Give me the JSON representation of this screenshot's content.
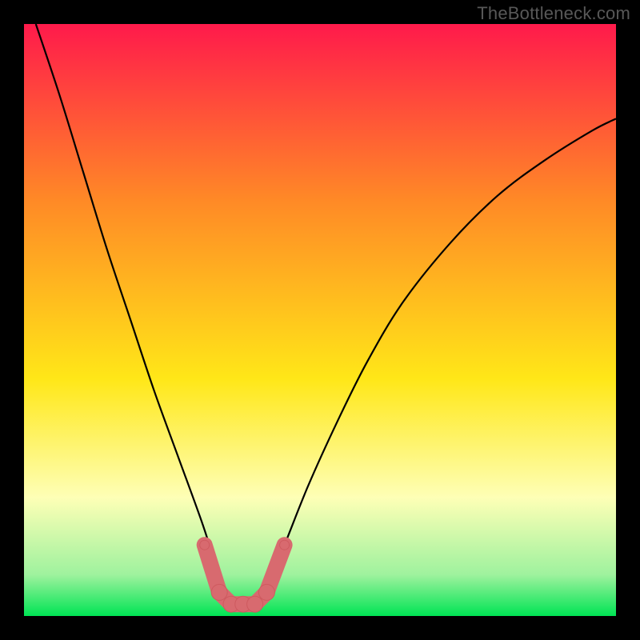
{
  "watermark": "TheBottleneck.com",
  "colors": {
    "page_bg": "#000000",
    "gradient_top": "#ff1a4b",
    "gradient_mid_upper": "#ff8a26",
    "gradient_mid": "#ffe718",
    "gradient_pale": "#feffb6",
    "gradient_green_soft": "#9ff29e",
    "gradient_green": "#00e454",
    "curve": "#000000",
    "marker_fill": "#d86a6f",
    "marker_stroke": "#ce5a5f"
  },
  "chart_data": {
    "type": "line",
    "title": "",
    "xlabel": "",
    "ylabel": "",
    "xlim": [
      0,
      1
    ],
    "ylim": [
      0,
      1
    ],
    "series": [
      {
        "name": "bottleneck-curve",
        "x": [
          0.02,
          0.06,
          0.1,
          0.14,
          0.18,
          0.22,
          0.26,
          0.3,
          0.33,
          0.355,
          0.38,
          0.41,
          0.44,
          0.48,
          0.53,
          0.58,
          0.64,
          0.72,
          0.8,
          0.88,
          0.96,
          1.0
        ],
        "y": [
          1.0,
          0.88,
          0.75,
          0.62,
          0.5,
          0.38,
          0.27,
          0.16,
          0.07,
          0.02,
          0.02,
          0.05,
          0.12,
          0.22,
          0.33,
          0.43,
          0.53,
          0.63,
          0.71,
          0.77,
          0.82,
          0.84
        ]
      }
    ],
    "markers": {
      "name": "highlight-points",
      "x": [
        0.305,
        0.33,
        0.35,
        0.37,
        0.39,
        0.41,
        0.44
      ],
      "y": [
        0.12,
        0.04,
        0.02,
        0.02,
        0.02,
        0.04,
        0.12
      ],
      "r": [
        6,
        10,
        10,
        10,
        10,
        10,
        6
      ]
    },
    "gradient_stops": [
      {
        "offset": 0.0,
        "color": "#ff1a4b"
      },
      {
        "offset": 0.3,
        "color": "#ff8a26"
      },
      {
        "offset": 0.6,
        "color": "#ffe718"
      },
      {
        "offset": 0.8,
        "color": "#feffb6"
      },
      {
        "offset": 0.93,
        "color": "#9ff29e"
      },
      {
        "offset": 1.0,
        "color": "#00e454"
      }
    ]
  }
}
